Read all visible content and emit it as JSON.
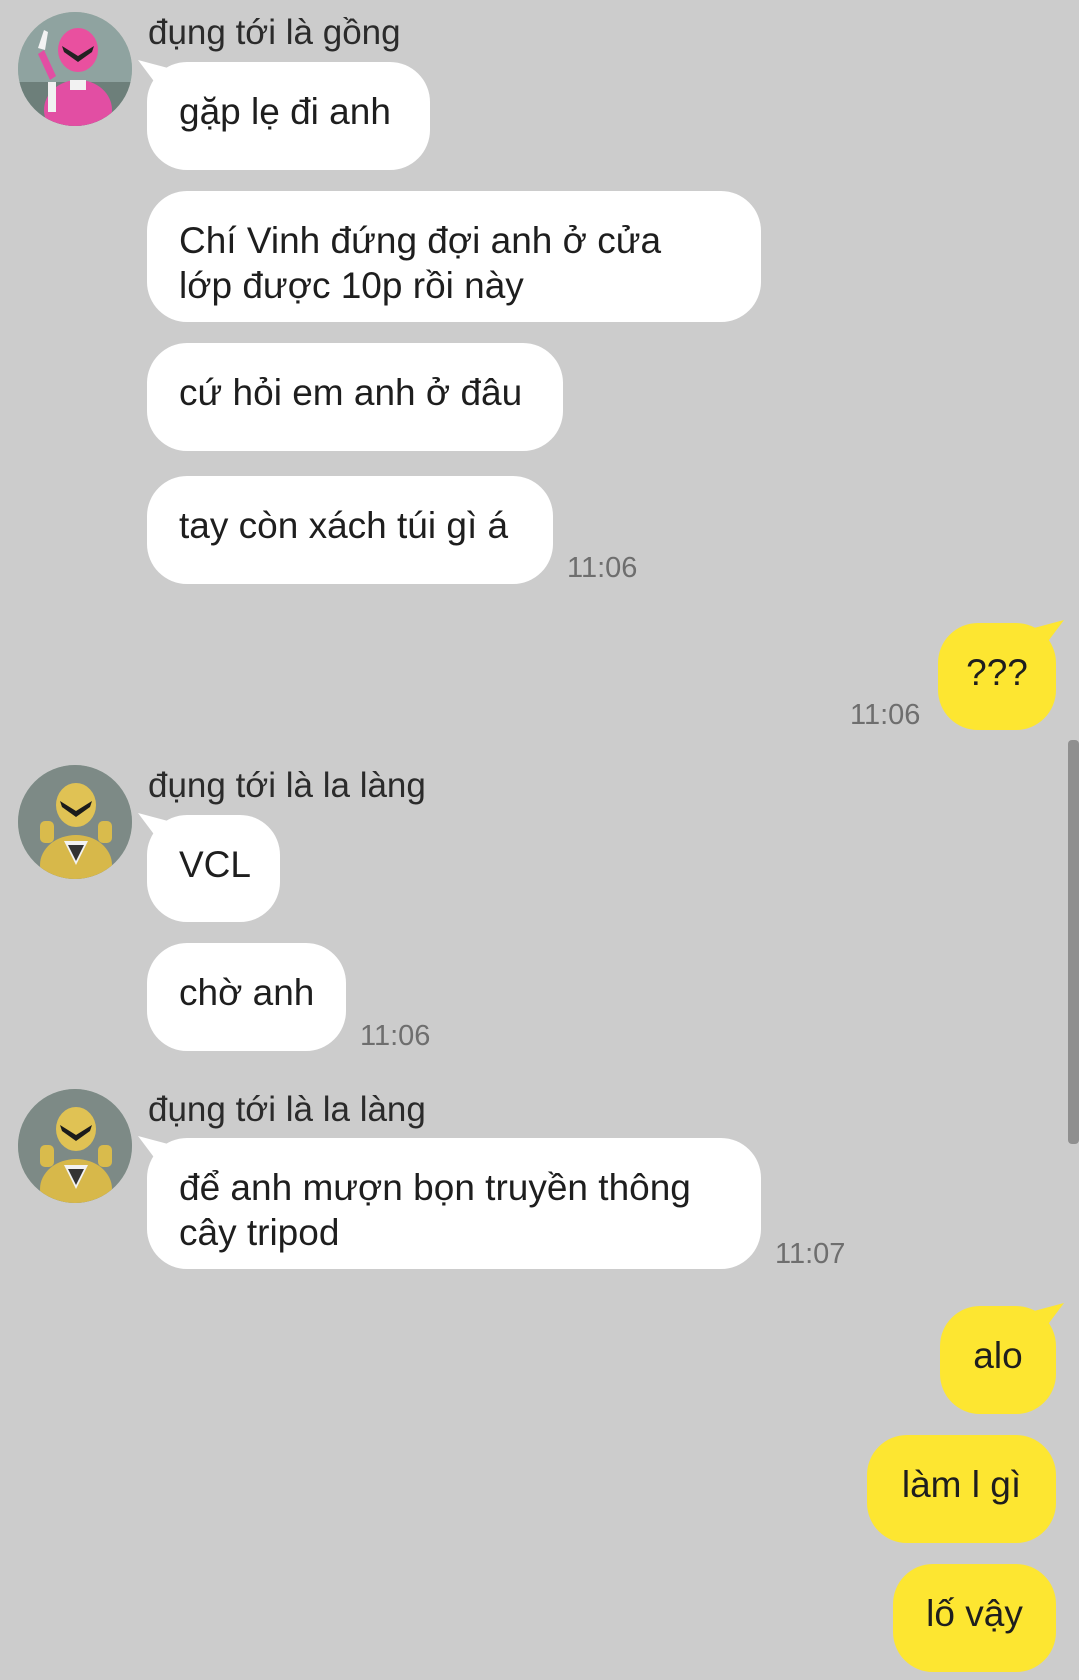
{
  "colors": {
    "background": "#cccccc",
    "incoming_bubble": "#ffffff",
    "outgoing_bubble": "#fde631",
    "timestamp": "#6e6e6e"
  },
  "groups": [
    {
      "sender": "đụng tới là gồng",
      "avatar_icon": "pink-ranger-avatar-icon",
      "messages": [
        "gặp lẹ đi anh",
        "Chí Vinh đứng đợi anh ở cửa",
        "lớp được 10p rồi này",
        "cứ hỏi em anh ở đâu",
        "tay còn xách túi gì á"
      ],
      "time": "11:06"
    },
    {
      "sender": "đụng tới là la làng",
      "avatar_icon": "yellow-ranger-avatar-icon",
      "messages": [
        "VCL",
        "chờ anh"
      ],
      "time": "11:06"
    },
    {
      "sender": "đụng tới là la làng",
      "avatar_icon": "yellow-ranger-avatar-icon",
      "messages": [
        "để anh mượn bọn truyền thông",
        "cây tripod"
      ],
      "time": "11:07"
    }
  ],
  "outgoing": [
    {
      "text": "???",
      "time": "11:06"
    },
    {
      "text": "alo"
    },
    {
      "text": "làm l gì"
    },
    {
      "text": "lố vậy"
    }
  ]
}
